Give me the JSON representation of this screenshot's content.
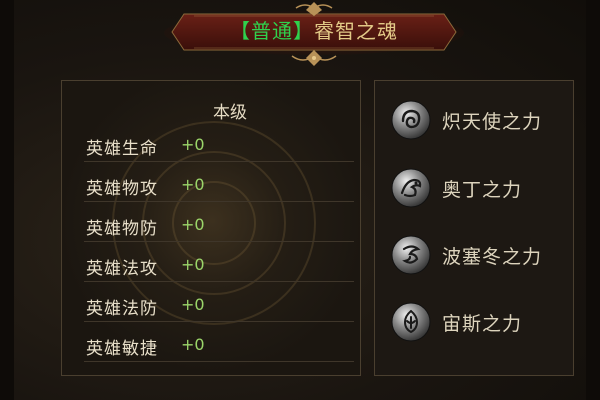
{
  "header": {
    "title_tag": "【普通】",
    "title_name": "睿智之魂"
  },
  "stats": {
    "column_header": "本级",
    "rows": [
      {
        "label": "英雄生命",
        "value": "+0"
      },
      {
        "label": "英雄物攻",
        "value": "+0"
      },
      {
        "label": "英雄物防",
        "value": "+0"
      },
      {
        "label": "英雄法攻",
        "value": "+0"
      },
      {
        "label": "英雄法防",
        "value": "+0"
      },
      {
        "label": "英雄敏捷",
        "value": "+0"
      }
    ]
  },
  "powers": {
    "items": [
      {
        "label": "炽天使之力",
        "icon": "seraph-swirl-icon"
      },
      {
        "label": "奥丁之力",
        "icon": "odin-raven-icon"
      },
      {
        "label": "波塞冬之力",
        "icon": "poseidon-wave-icon"
      },
      {
        "label": "宙斯之力",
        "icon": "zeus-crest-icon"
      }
    ]
  },
  "colors": {
    "title_tag": "#2fd14d",
    "title_name": "#e2c987",
    "stat_value": "#9bd66a",
    "banner": "#5a1a12"
  }
}
